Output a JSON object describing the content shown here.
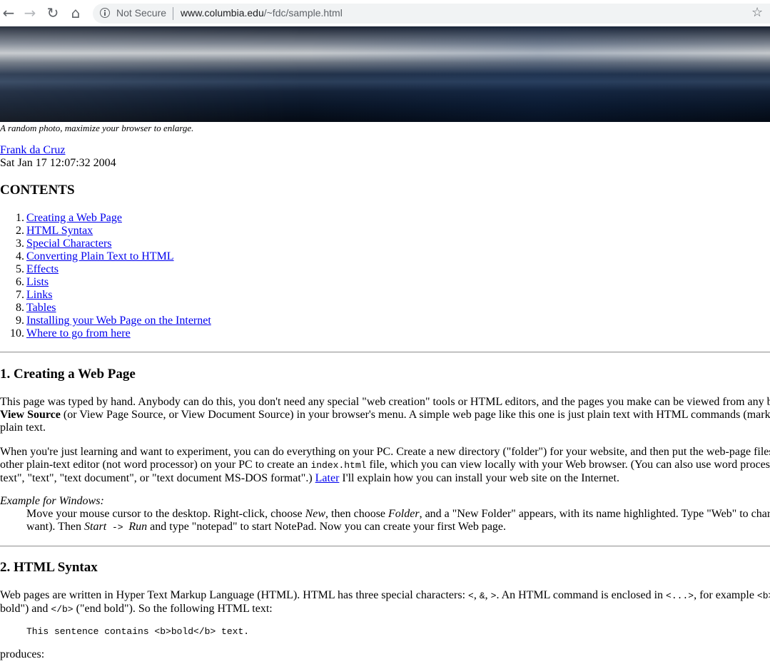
{
  "browser": {
    "security_label": "Not Secure",
    "url_domain": "www.columbia.edu",
    "url_path": "/~fdc/sample.html",
    "icons": [
      "back-arrow-icon",
      "forward-arrow-icon",
      "reload-icon",
      "home-icon",
      "info-icon",
      "star-icon"
    ]
  },
  "page": {
    "caption": "A random photo, maximize your browser to enlarge.",
    "author": "Frank da Cruz",
    "date": "Sat Jan 17 12:07:32 2004",
    "contents_heading": "CONTENTS",
    "toc": [
      {
        "num": "1.",
        "label": "Creating a Web Page"
      },
      {
        "num": "2.",
        "label": "HTML Syntax"
      },
      {
        "num": "3.",
        "label": "Special Characters"
      },
      {
        "num": "4.",
        "label": "Converting Plain Text to HTML"
      },
      {
        "num": "5.",
        "label": "Effects"
      },
      {
        "num": "6.",
        "label": "Lists"
      },
      {
        "num": "7.",
        "label": "Links"
      },
      {
        "num": "8.",
        "label": "Tables"
      },
      {
        "num": "9.",
        "label": "Installing your Web Page on the Internet"
      },
      {
        "num": "10.",
        "label": "Where to go from here"
      }
    ],
    "section1": {
      "heading": "1. Creating a Web Page",
      "p1_line1": "This page was typed by hand. Anybody can do this, you don't need any special \"web creation\" tools or HTML editors, and the pages you make can be viewed from any b",
      "p1_line2_bold": "View Source",
      "p1_line2_rest": " (or View Page Source, or View Document Source) in your browser's menu. A simple web page like this one is just plain text with HTML commands (mark",
      "p1_line3": "plain text.",
      "p2_line1": "When you're just learning and want to experiment, you can do everything on your PC. Create a new directory (\"folder\") for your website, and then put the web-page files",
      "p2_line2_a": "other plain-text editor (not word processor) on your PC to create an ",
      "p2_line2_code": "index.html",
      "p2_line2_b": " file, which you can view locally with your Web browser. (You can also use word process",
      "p2_line3_a": "text\", \"text\", \"text document\", or \"text document MS-DOS format\".) ",
      "p2_line3_link": "Later",
      "p2_line3_b": " I'll explain how you can install your web site on the Internet.",
      "example_label": "Example for Windows:",
      "ex_line1_a": "Move your mouse cursor to the desktop. Right-click, choose ",
      "ex_line1_new": "New",
      "ex_line1_b": ", then choose ",
      "ex_line1_folder": "Folder",
      "ex_line1_c": ", and a \"New Folder\" appears, with its name highlighted. Type \"Web\" to char",
      "ex_line2_a": "want). Then ",
      "ex_line2_start": "Start",
      "ex_line2_arrow": " -> ",
      "ex_line2_run": "Run",
      "ex_line2_b": " and type \"notepad\" to start NotePad. Now you can create your first Web page."
    },
    "section2": {
      "heading": "2. HTML Syntax",
      "p1_line1_a": "Web pages are written in Hyper Text Markup Language (HTML). HTML has three special characters: ",
      "p1_line1_c1": "<",
      "p1_sep1": ", ",
      "p1_line1_c2": "&",
      "p1_sep2": ", ",
      "p1_line1_c3": ">",
      "p1_line1_b": ". An HTML command is enclosed in ",
      "p1_line1_c4": "<...>",
      "p1_line1_c": ", for example ",
      "p1_line1_c5": "<b>",
      "p1_line2_a": "bold\") and ",
      "p1_line2_code": "</b>",
      "p1_line2_b": " (\"end bold\"). So the following HTML text:",
      "pre": "This sentence contains <b>bold</b> text.",
      "produces": "produces:"
    }
  }
}
